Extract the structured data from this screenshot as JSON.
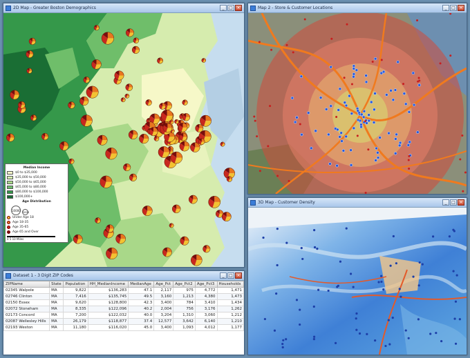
{
  "windows": {
    "map1_title": "2D Map - Greater Boston Demographics",
    "map2_title": "Map 2 - Store & Customer Locations",
    "map3_title": "3D Map - Customer Density",
    "table_title": "Dataset 1 - 3 Digit ZIP Codes"
  },
  "legend": {
    "title": "Median Income",
    "ranges": [
      {
        "label": "$0 to $35,000",
        "color": "#f6f8c8"
      },
      {
        "label": "$35,000 to $50,000",
        "color": "#d6ecae"
      },
      {
        "label": "$50,000 to $65,000",
        "color": "#a9d889"
      },
      {
        "label": "$65,000 to $80,000",
        "color": "#6fbe6a"
      },
      {
        "label": "$80,000 to $100,000",
        "color": "#35984a"
      },
      {
        "label": "$100,000+",
        "color": "#1a6e34"
      }
    ],
    "pie_title": "Age Distribution",
    "sizes": [
      "10000",
      "5000"
    ],
    "slices": [
      {
        "label": "Under Age 18",
        "color": "#f3c232"
      },
      {
        "label": "Age 18-35",
        "color": "#e8761f"
      },
      {
        "label": "Age 35-65",
        "color": "#c8281e"
      },
      {
        "label": "Age 65 and Over",
        "color": "#7a0c0c"
      }
    ],
    "scale": "0      5      10 Miles"
  },
  "table": {
    "columns": [
      "ZIPName",
      "State",
      "Population",
      "HH_MedianIncome",
      "MedianAge",
      "Age_Pct",
      "Age_Pct2",
      "Age_Pct3",
      "Households"
    ],
    "rows": [
      [
        "02345 Walpole",
        "MA",
        "9,822",
        "$136,283",
        "47.1",
        "2,117",
        "975",
        "4,772",
        "1,471"
      ],
      [
        "02746 Clinton",
        "MA",
        "7,416",
        "$135,745",
        "49.5",
        "3,160",
        "1,213",
        "4,380",
        "1,473"
      ],
      [
        "02150 Essex",
        "MA",
        "9,620",
        "$128,800",
        "42.3",
        "3,400",
        "784",
        "3,410",
        "1,434"
      ],
      [
        "02072 Stoneham",
        "MA",
        "8,335",
        "$122,096",
        "40.2",
        "2,004",
        "756",
        "3,176",
        "1,262"
      ],
      [
        "02173 Concord",
        "MA",
        "7,200",
        "$122,032",
        "40.0",
        "3,204",
        "1,310",
        "3,060",
        "1,212"
      ],
      [
        "02087 Wellesley Hills",
        "MA",
        "26,179",
        "$118,877",
        "37.4",
        "12,577",
        "3,642",
        "6,140",
        "1,210"
      ],
      [
        "02193 Weston",
        "MA",
        "11,180",
        "$116,020",
        "45.0",
        "3,400",
        "1,093",
        "4,012",
        "1,177"
      ]
    ]
  }
}
